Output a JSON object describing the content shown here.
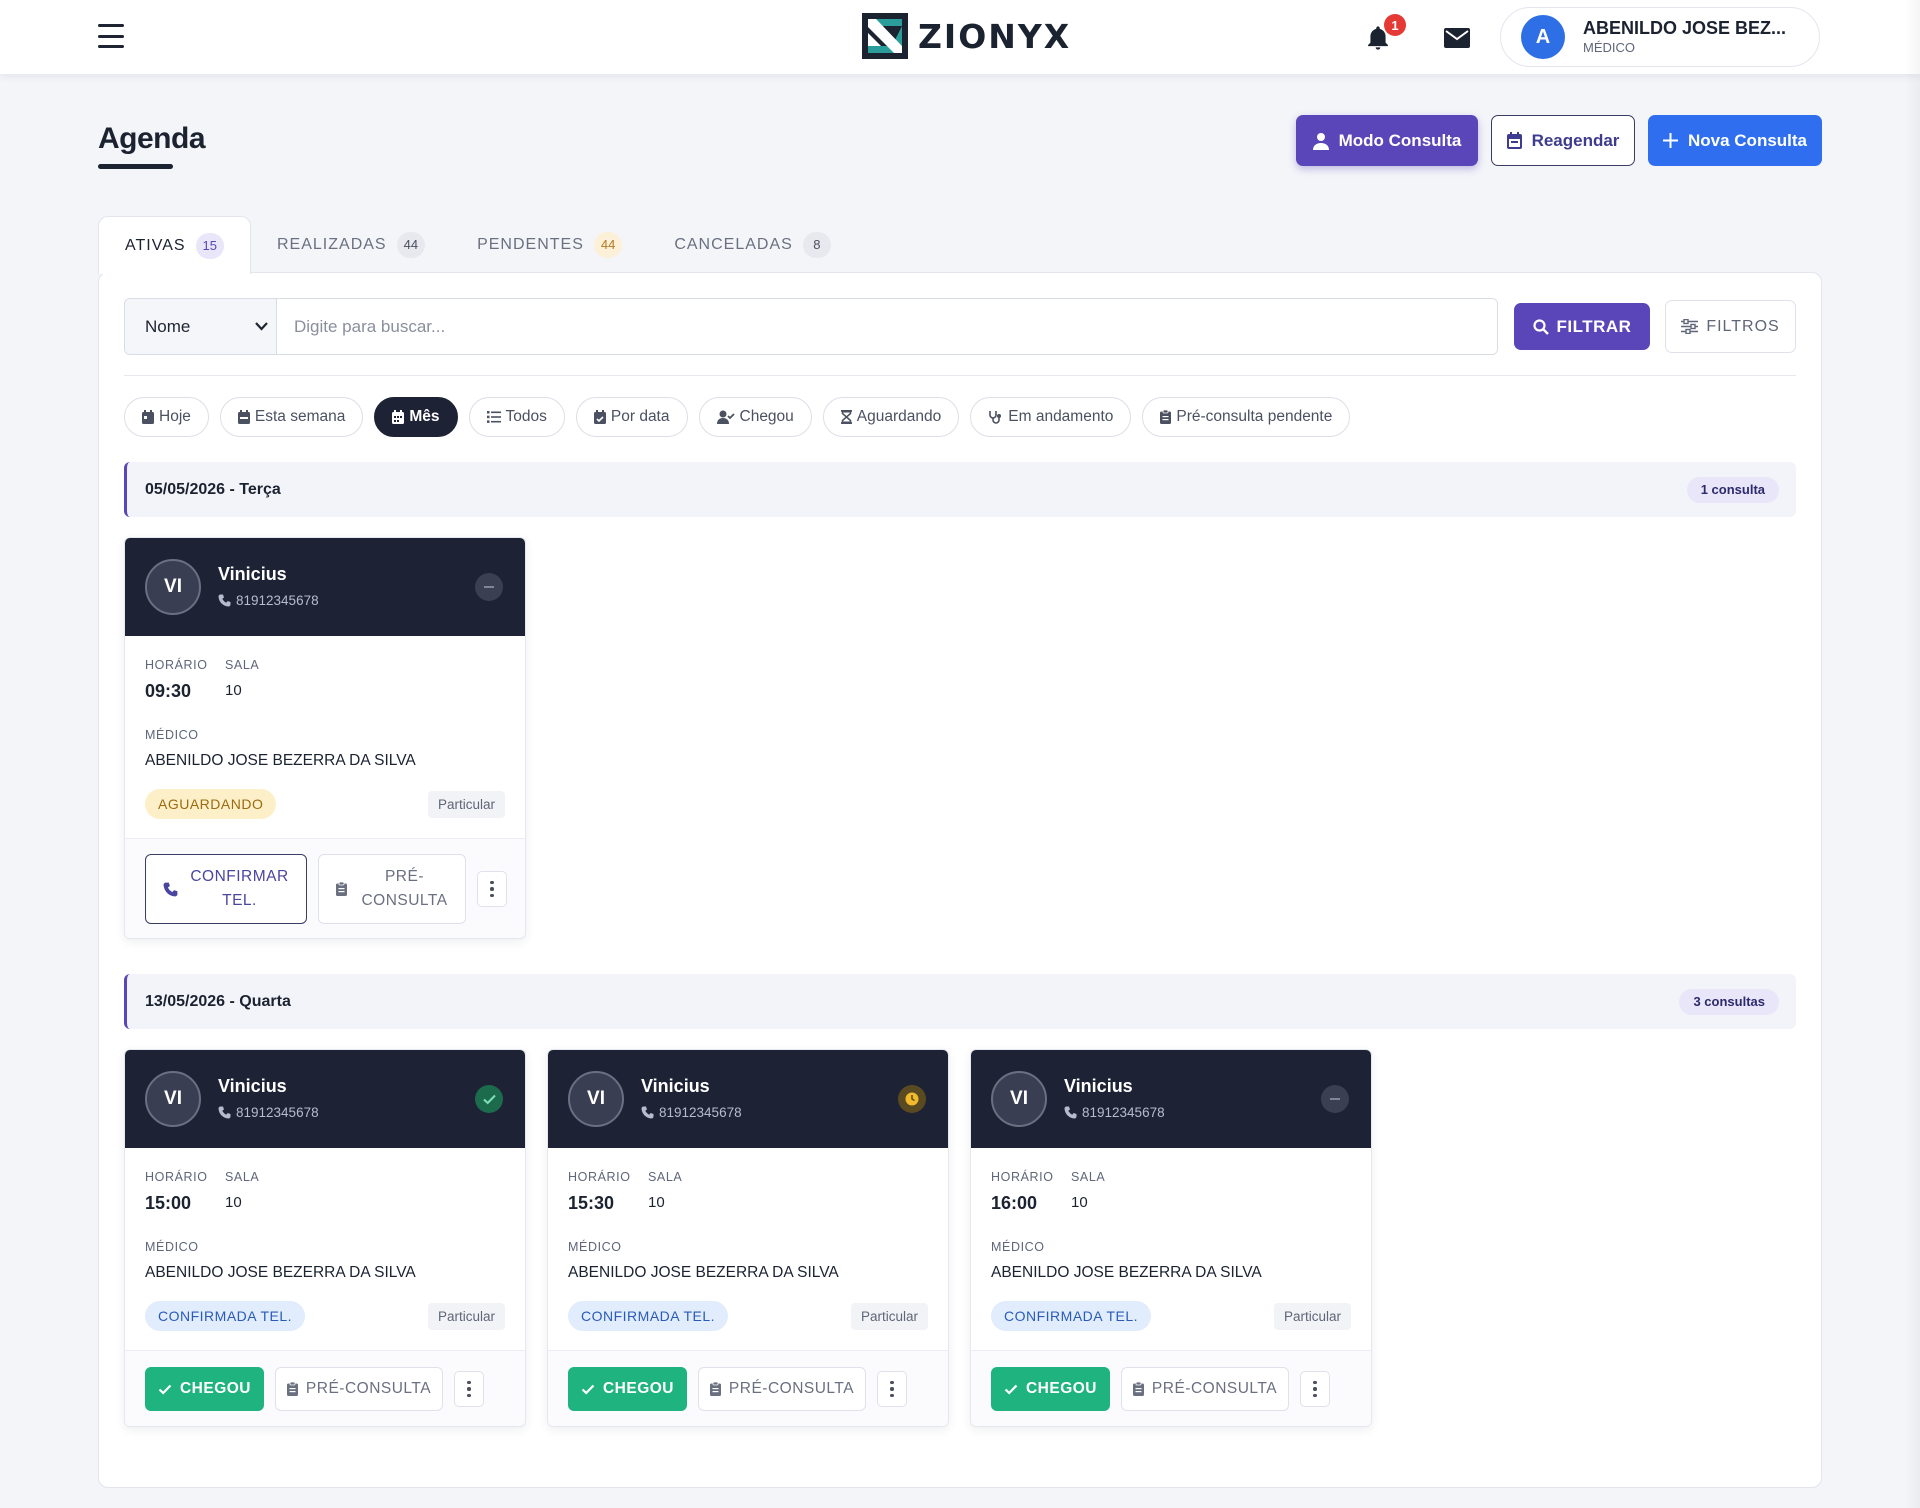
{
  "topbar": {
    "brand": "ZIONYX",
    "notification_count": "1",
    "user": {
      "initial": "A",
      "name": "ABENILDO JOSE BEZ...",
      "role": "MÉDICO"
    }
  },
  "page": {
    "title": "Agenda",
    "actions": {
      "modo_consulta": "Modo Consulta",
      "reagendar": "Reagendar",
      "nova_consulta": "Nova Consulta"
    }
  },
  "tabs": [
    {
      "label": "ATIVAS",
      "count": "15",
      "active": true
    },
    {
      "label": "REALIZADAS",
      "count": "44"
    },
    {
      "label": "PENDENTES",
      "count": "44"
    },
    {
      "label": "CANCELADAS",
      "count": "8"
    }
  ],
  "search": {
    "field_selected": "Nome",
    "placeholder": "Digite para buscar...",
    "filter_button": "FILTRAR",
    "filters_button": "FILTROS"
  },
  "chips": [
    {
      "label": "Hoje",
      "icon": "calendar-day-icon"
    },
    {
      "label": "Esta semana",
      "icon": "calendar-week-icon"
    },
    {
      "label": "Mês",
      "icon": "calendar-month-icon",
      "active": true
    },
    {
      "label": "Todos",
      "icon": "list-icon"
    },
    {
      "label": "Por data",
      "icon": "calendar-check-icon"
    },
    {
      "label": "Chegou",
      "icon": "user-check-icon"
    },
    {
      "label": "Aguardando",
      "icon": "hourglass-icon"
    },
    {
      "label": "Em andamento",
      "icon": "stethoscope-icon"
    },
    {
      "label": "Pré-consulta pendente",
      "icon": "clipboard-icon"
    }
  ],
  "labels": {
    "horario": "HORÁRIO",
    "sala": "SALA",
    "medico": "MÉDICO"
  },
  "groups": [
    {
      "date": "05/05/2026 - Terça",
      "count": "1 consulta",
      "cards": [
        {
          "initials": "VI",
          "name": "Vinicius",
          "phone": "81912345678",
          "status_icon": "minus-icon",
          "time": "09:30",
          "room": "10",
          "doctor": "ABENILDO JOSE BEZERRA DA SILVA",
          "status": "AGUARDANDO",
          "payment": "Particular",
          "actions": {
            "confirm": [
              "CONFIRMAR",
              "TEL."
            ],
            "pre": [
              "PRÉ-",
              "CONSULTA"
            ]
          }
        }
      ]
    },
    {
      "date": "13/05/2026 - Quarta",
      "count": "3 consultas",
      "cards": [
        {
          "initials": "VI",
          "name": "Vinicius",
          "phone": "81912345678",
          "status_icon": "check-icon",
          "time": "15:00",
          "room": "10",
          "doctor": "ABENILDO JOSE BEZERRA DA SILVA",
          "status": "CONFIRMADA TEL.",
          "payment": "Particular",
          "actions": {
            "chegou": "CHEGOU",
            "pre": "PRÉ-CONSULTA"
          }
        },
        {
          "initials": "VI",
          "name": "Vinicius",
          "phone": "81912345678",
          "status_icon": "clock-icon",
          "time": "15:30",
          "room": "10",
          "doctor": "ABENILDO JOSE BEZERRA DA SILVA",
          "status": "CONFIRMADA TEL.",
          "payment": "Particular",
          "actions": {
            "chegou": "CHEGOU",
            "pre": "PRÉ-CONSULTA"
          }
        },
        {
          "initials": "VI",
          "name": "Vinicius",
          "phone": "81912345678",
          "status_icon": "minus-icon",
          "time": "16:00",
          "room": "10",
          "doctor": "ABENILDO JOSE BEZERRA DA SILVA",
          "status": "CONFIRMADA TEL.",
          "payment": "Particular",
          "actions": {
            "chegou": "CHEGOU",
            "pre": "PRÉ-CONSULTA"
          }
        }
      ]
    }
  ],
  "colors": {
    "primary_purple": "#5a46b8",
    "primary_blue": "#2f6fef",
    "dark_header": "#1e2235",
    "success_green": "#1fb47f"
  }
}
